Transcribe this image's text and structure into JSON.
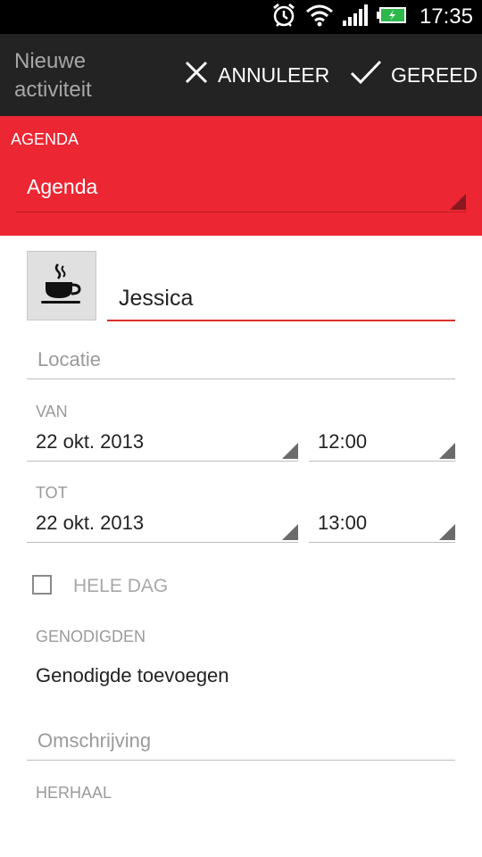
{
  "status": {
    "time": "17:35"
  },
  "actionbar": {
    "title": "Nieuwe activiteit",
    "cancel_label": "ANNULEER",
    "done_label": "GEREED"
  },
  "calendar": {
    "section_label": "AGENDA",
    "selected": "Agenda"
  },
  "event": {
    "icon": "coffee-cup-icon",
    "title_value": "Jessica",
    "location_placeholder": "Locatie",
    "from_label": "VAN",
    "from_date": "22 okt. 2013",
    "from_time": "12:00",
    "to_label": "TOT",
    "to_date": "22 okt. 2013",
    "to_time": "13:00",
    "allday_label": "HELE DAG",
    "guests_label": "GENODIGDEN",
    "add_guest": "Genodigde toevoegen",
    "description_placeholder": "Omschrijving",
    "repeat_label": "HERHAAL"
  },
  "colors": {
    "accent": "#ed2633",
    "actionbar": "#232323",
    "title_underline": "#d9302d"
  }
}
